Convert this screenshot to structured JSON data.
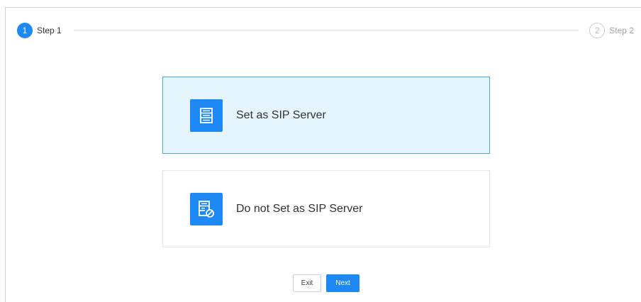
{
  "stepper": {
    "steps": [
      {
        "number": "1",
        "label": "Step 1",
        "state": "active"
      },
      {
        "number": "2",
        "label": "Step 2",
        "state": "inactive"
      }
    ]
  },
  "options": [
    {
      "label": "Set as SIP Server",
      "icon": "server-icon",
      "selected": true
    },
    {
      "label": "Do not Set as SIP Server",
      "icon": "server-disabled-icon",
      "selected": false
    }
  ],
  "actions": {
    "exit_label": "Exit",
    "next_label": "Next"
  },
  "colors": {
    "accent": "#1e88f5",
    "selected_bg": "#e5f5fd",
    "selected_border": "#46a7e6"
  }
}
